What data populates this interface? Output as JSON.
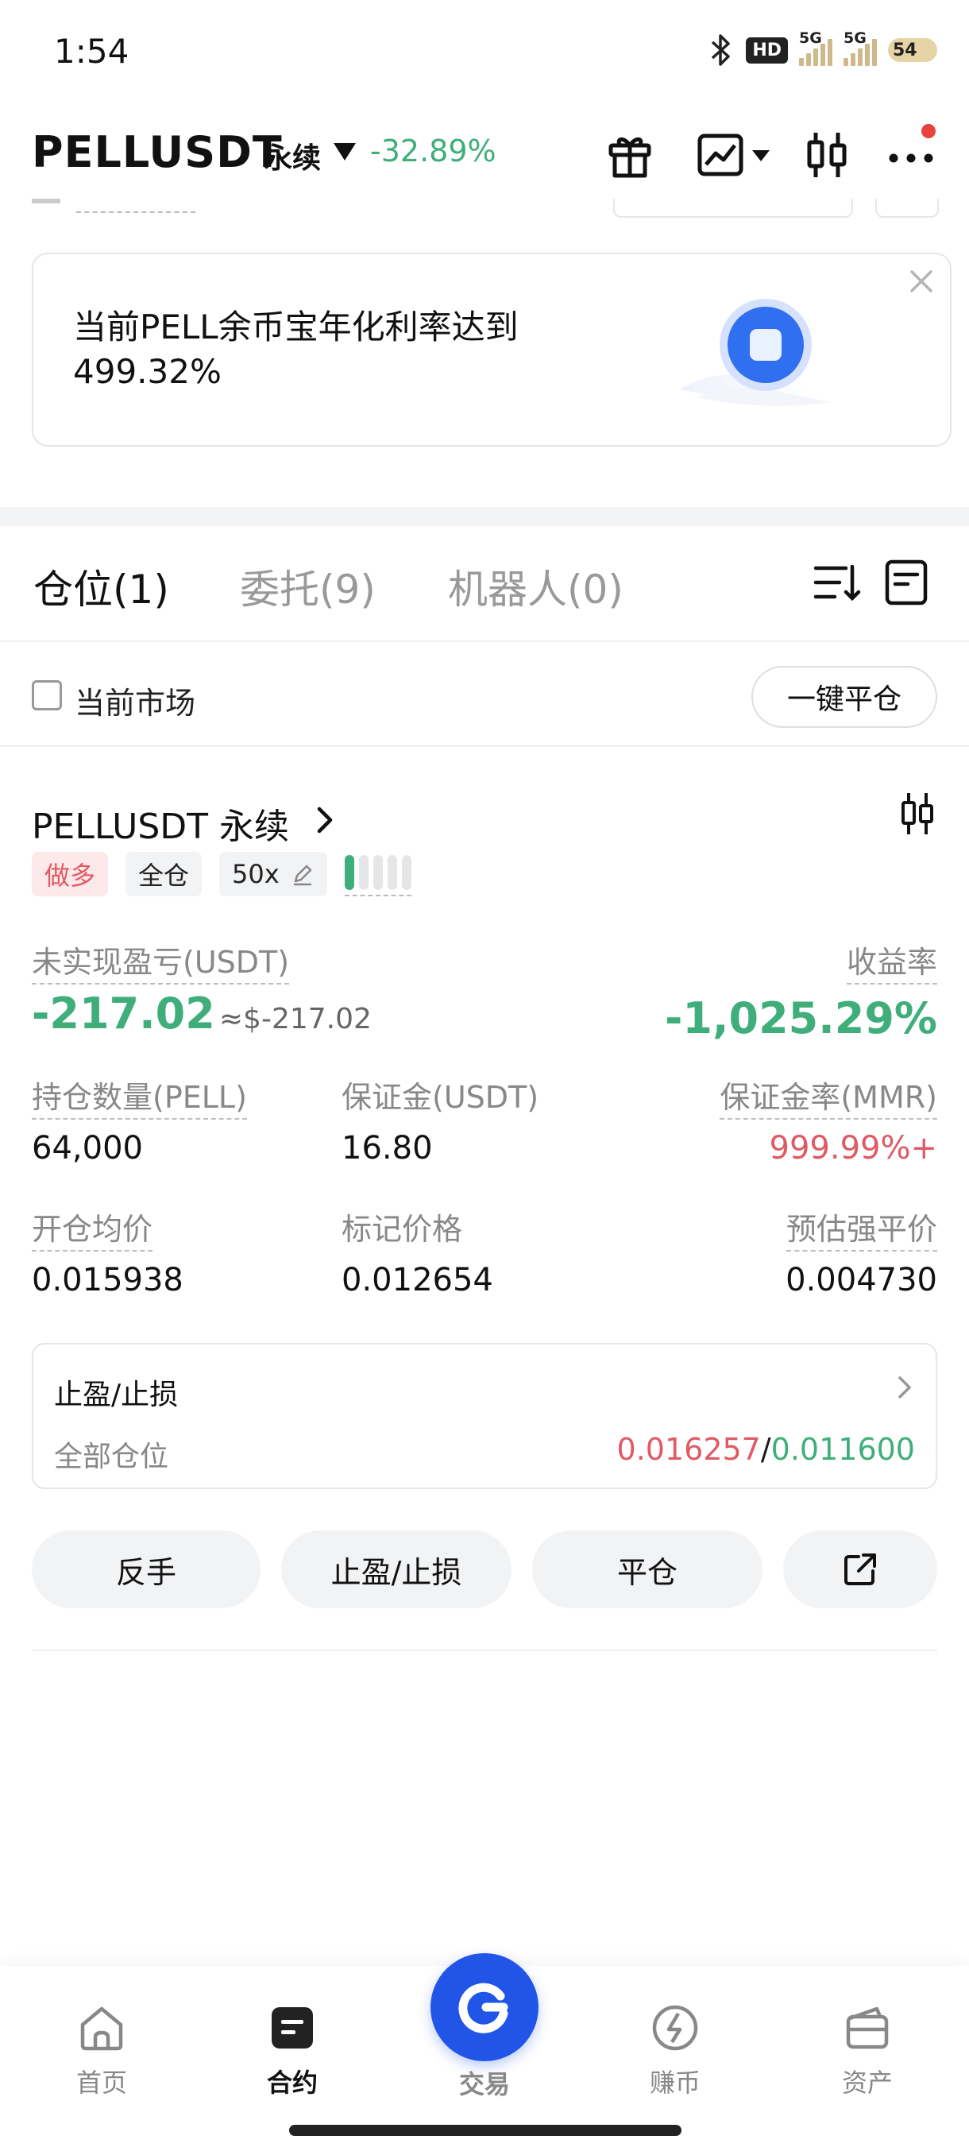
{
  "status_bar": {
    "time": "1:54",
    "hd_label": "HD",
    "signal1_label": "5G",
    "signal2_label": "5G",
    "battery": "54"
  },
  "header": {
    "symbol": "PELLUSDT",
    "contract_type": "永续",
    "change_pct": "-32.89%",
    "change_color": "#3fae7a"
  },
  "banner": {
    "text": "当前PELL余币宝年化利率达到499.32%",
    "accent_color": "#2f6ff0"
  },
  "tabs": [
    {
      "label": "仓位(1)",
      "active": true
    },
    {
      "label": "委托(9)",
      "active": false
    },
    {
      "label": "机器人(0)",
      "active": false
    }
  ],
  "filter": {
    "current_market_label": "当前市场",
    "close_all_label": "一键平仓"
  },
  "position": {
    "title": "PELLUSDT 永续",
    "side_tag": "做多",
    "margin_mode_tag": "全仓",
    "leverage_tag": "50x",
    "unrealized_pnl_label": "未实现盈亏(USDT)",
    "unrealized_pnl": "-217.02",
    "unrealized_pnl_usd": "≈$-217.02",
    "roe_label": "收益率",
    "roe": "-1,025.29%",
    "size_label": "持仓数量(PELL)",
    "size": "64,000",
    "margin_label": "保证金(USDT)",
    "margin": "16.80",
    "mmr_label": "保证金率(MMR)",
    "mmr": "999.99%+",
    "entry_label": "开仓均价",
    "entry": "0.015938",
    "mark_label": "标记价格",
    "mark": "0.012654",
    "liq_label": "预估强平价",
    "liq": "0.004730",
    "up_color": "#3fae7a",
    "down_color": "#e05a64"
  },
  "tpsl": {
    "title": "止盈/止损",
    "scope": "全部仓位",
    "tp": "0.016257",
    "separator": "/",
    "sl": "0.011600"
  },
  "actions": {
    "reverse": "反手",
    "tpsl": "止盈/止损",
    "close": "平仓"
  },
  "bottom_nav": [
    {
      "label": "首页",
      "icon": "home-icon"
    },
    {
      "label": "合约",
      "icon": "contract-icon",
      "active": true
    },
    {
      "label": "交易",
      "icon": "trade-icon"
    },
    {
      "label": "赚币",
      "icon": "earn-icon"
    },
    {
      "label": "资产",
      "icon": "wallet-icon"
    }
  ]
}
